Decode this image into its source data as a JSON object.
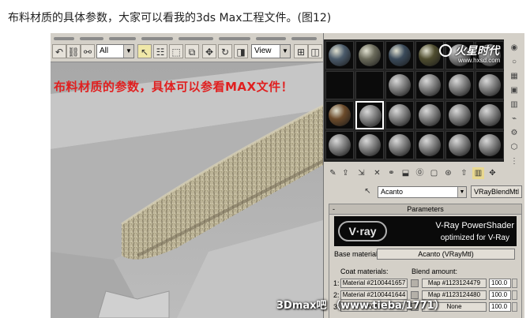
{
  "caption": "布料材质的具体参数，大家可以看我的3ds Max工程文件。(图12)",
  "toolbar": {
    "filter_select": "All",
    "view_select": "View",
    "buttons": [
      {
        "name": "undo-icon",
        "glyph": "↶"
      },
      {
        "name": "link-icon",
        "glyph": "⛓"
      },
      {
        "name": "unlink-icon",
        "glyph": "⚯"
      },
      {
        "name": "bind-spacewarp-icon",
        "glyph": "~"
      },
      {
        "name": "select-arrow-icon",
        "glyph": "↖"
      },
      {
        "name": "select-by-name-icon",
        "glyph": "☷"
      },
      {
        "name": "select-region-icon",
        "glyph": "⬚"
      },
      {
        "name": "window-crossing-icon",
        "glyph": "⧉"
      },
      {
        "name": "move-icon",
        "glyph": "✥"
      },
      {
        "name": "rotate-icon",
        "glyph": "↻"
      },
      {
        "name": "scale-icon",
        "glyph": "◨"
      },
      {
        "name": "pivot-icon",
        "glyph": "⊞"
      }
    ]
  },
  "viewport": {
    "note": "布料材质的参数，具体可以参看MAX文件！"
  },
  "watermark": {
    "main": "火星时代",
    "sub": "www.hxsd.com"
  },
  "material_editor": {
    "material_name": "Acanto",
    "material_type": "VRayBlendMtl",
    "params_title": "Parameters",
    "collapse": "-",
    "vray_logo": "V·ray",
    "banner_line1": "V-Ray PowerShader",
    "banner_line2": "optimized for V-Ray",
    "base_material_label": "Base material:",
    "base_material_value": "Acanto (VRayMtl)",
    "coat_header": "Coat materials:",
    "blend_header": "Blend amount:",
    "coats": [
      {
        "index": "1:",
        "material": "Material #2100441657",
        "map": "Map #1123124479",
        "amount": "100.0"
      },
      {
        "index": "2:",
        "material": "Material #2100441644",
        "map": "Map #1123124480",
        "amount": "100.0"
      },
      {
        "index": "3:",
        "material": "None",
        "map": "None",
        "amount": "100.0"
      }
    ],
    "tool_icons": [
      "get-material-icon",
      "put-to-scene-icon",
      "assign-material-icon",
      "delete-icon",
      "make-unique-icon",
      "put-to-library-icon",
      "material-effects-icon",
      "show-map-icon",
      "show-end-result-icon",
      "go-to-parent-icon",
      "go-forward-icon"
    ],
    "side_icons": [
      "sample-type-icon",
      "backlight-icon",
      "background-icon",
      "uv-tiling-icon",
      "video-check-icon",
      "make-preview-icon",
      "options-icon",
      "select-by-material-icon",
      "material-navigator-icon"
    ],
    "slots": [
      {
        "kind": "texture",
        "color": "#4a5a6a"
      },
      {
        "kind": "texture",
        "color": "#6a6a5a"
      },
      {
        "kind": "texture",
        "color": "#3a4a5a"
      },
      {
        "kind": "texture",
        "color": "#4f4d2f"
      },
      {
        "kind": "gray",
        "color": "#888888"
      },
      {
        "kind": "gray",
        "color": "#888888"
      },
      {
        "kind": "black",
        "color": "#111111"
      },
      {
        "kind": "black",
        "color": "#111111"
      },
      {
        "kind": "gray",
        "color": "#888888"
      },
      {
        "kind": "gray",
        "color": "#888888"
      },
      {
        "kind": "gray",
        "color": "#888888"
      },
      {
        "kind": "gray",
        "color": "#888888"
      },
      {
        "kind": "texture",
        "color": "#6b4a2a"
      },
      {
        "kind": "gray-active",
        "color": "#888888"
      },
      {
        "kind": "gray",
        "color": "#888888"
      },
      {
        "kind": "gray",
        "color": "#888888"
      },
      {
        "kind": "gray",
        "color": "#888888"
      },
      {
        "kind": "gray",
        "color": "#888888"
      },
      {
        "kind": "gray",
        "color": "#888888"
      },
      {
        "kind": "gray",
        "color": "#888888"
      },
      {
        "kind": "gray",
        "color": "#888888"
      },
      {
        "kind": "gray",
        "color": "#888888"
      },
      {
        "kind": "gray",
        "color": "#888888"
      },
      {
        "kind": "gray",
        "color": "#888888"
      }
    ]
  },
  "forum_watermark": "3Dmax吧 （www.tieba/1771）",
  "colors": {
    "note_red": "#e02020",
    "ui_gray": "#d4d0c8",
    "viewport_gray": "#b9b9b9",
    "fur_light": "#c8c0a0",
    "fur_dark": "#6e6450"
  }
}
